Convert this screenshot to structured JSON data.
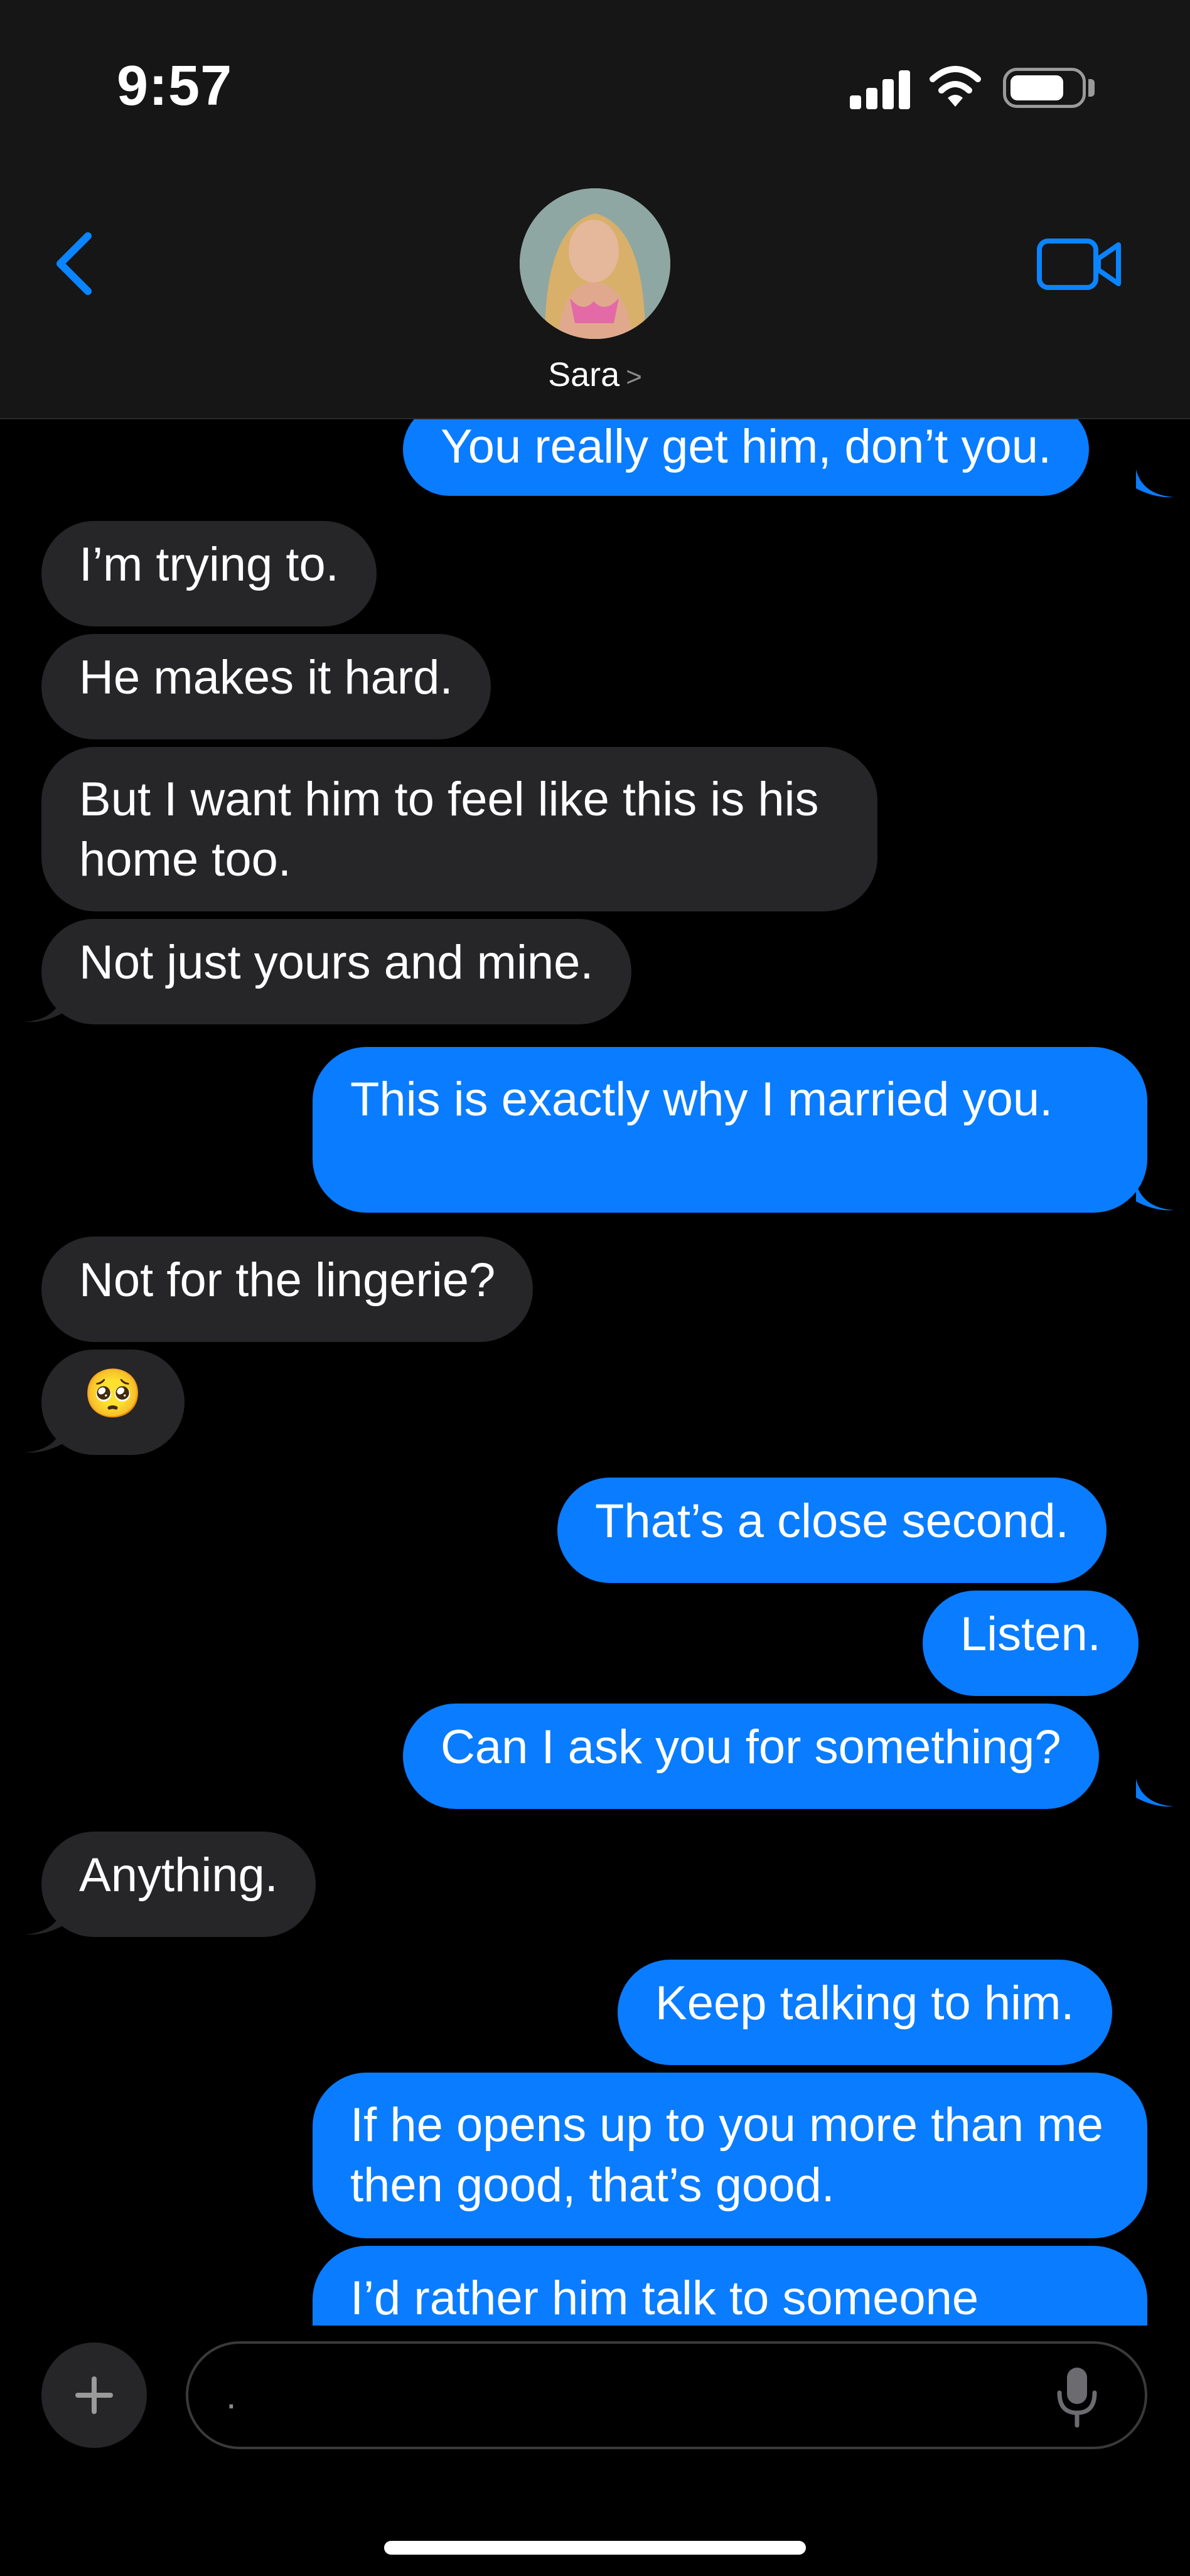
{
  "status_bar": {
    "time": "9:57"
  },
  "header": {
    "contact_name": "Sara",
    "chevron": ">"
  },
  "messages": [
    {
      "dir": "out",
      "text": "You really get him, don’t you."
    },
    {
      "dir": "in",
      "text": "I’m trying to."
    },
    {
      "dir": "in",
      "text": "He makes it hard."
    },
    {
      "dir": "in",
      "text": "But I want him to feel like this is his home too."
    },
    {
      "dir": "in",
      "text": "Not just yours and mine."
    },
    {
      "dir": "out",
      "text": "This is exactly why I married you."
    },
    {
      "dir": "in",
      "text": "Not for the lingerie?"
    },
    {
      "dir": "in",
      "text": "🥺"
    },
    {
      "dir": "out",
      "text": "That’s a close second."
    },
    {
      "dir": "out",
      "text": "Listen."
    },
    {
      "dir": "out",
      "text": "Can I ask you for something?"
    },
    {
      "dir": "in",
      "text": "Anything."
    },
    {
      "dir": "out",
      "text": "Keep talking to him."
    },
    {
      "dir": "out",
      "text": "If he opens up to you more than me then good, that’s good."
    },
    {
      "dir": "out",
      "text": "I’d rather him talk to someone"
    }
  ],
  "composer": {
    "value": "."
  },
  "colors": {
    "incoming": "#262628",
    "outgoing": "#0a7cff",
    "accent": "#0a84ff"
  },
  "icons": {
    "back": "chevron-left-icon",
    "video": "video-camera-icon",
    "plus": "plus-icon",
    "mic": "microphone-icon"
  }
}
